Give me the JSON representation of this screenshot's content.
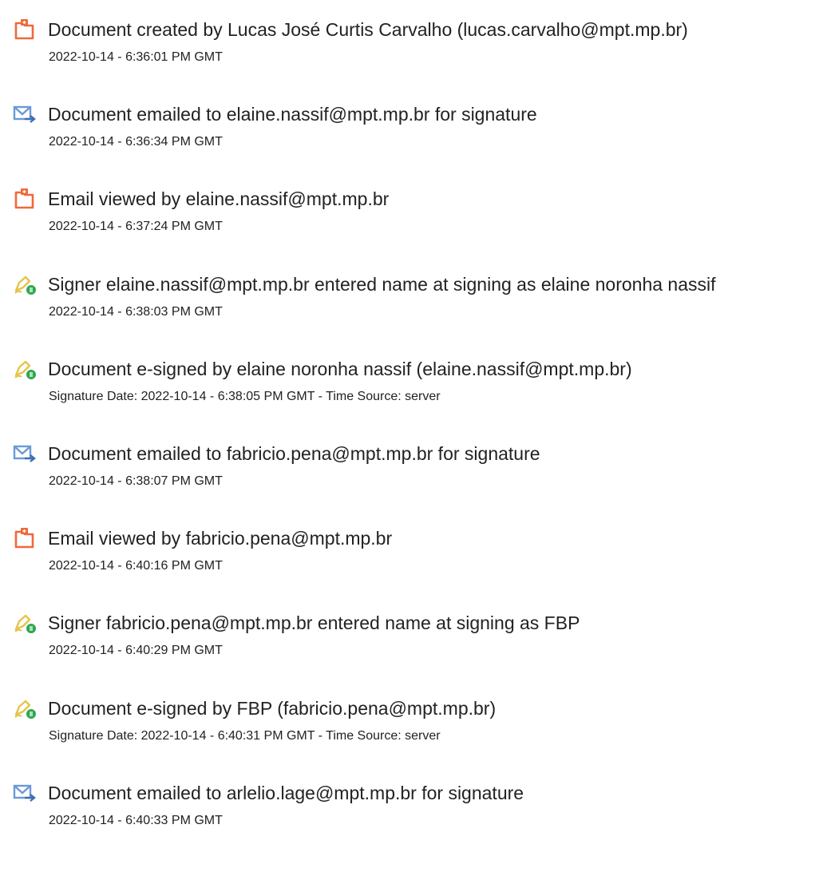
{
  "events": [
    {
      "icon": "document-created-icon",
      "title": "Document created by Lucas José Curtis Carvalho (lucas.carvalho@mpt.mp.br)",
      "detail": "2022-10-14 - 6:36:01 PM GMT"
    },
    {
      "icon": "email-sent-icon",
      "title": "Document emailed to elaine.nassif@mpt.mp.br for signature",
      "detail": "2022-10-14 - 6:36:34 PM GMT"
    },
    {
      "icon": "document-viewed-icon",
      "title": "Email viewed by elaine.nassif@mpt.mp.br",
      "detail": "2022-10-14 - 6:37:24 PM GMT"
    },
    {
      "icon": "pen-esign-icon",
      "title": "Signer elaine.nassif@mpt.mp.br entered name at signing as elaine noronha nassif",
      "detail": "2022-10-14 - 6:38:03 PM GMT"
    },
    {
      "icon": "pen-esign-icon",
      "title": "Document e-signed by elaine noronha nassif (elaine.nassif@mpt.mp.br)",
      "detail": "Signature Date: 2022-10-14 - 6:38:05 PM GMT - Time Source: server"
    },
    {
      "icon": "email-sent-icon",
      "title": "Document emailed to fabricio.pena@mpt.mp.br for signature",
      "detail": "2022-10-14 - 6:38:07 PM GMT"
    },
    {
      "icon": "document-viewed-icon",
      "title": "Email viewed by fabricio.pena@mpt.mp.br",
      "detail": "2022-10-14 - 6:40:16 PM GMT"
    },
    {
      "icon": "pen-esign-icon",
      "title": "Signer fabricio.pena@mpt.mp.br entered name at signing as FBP",
      "detail": "2022-10-14 - 6:40:29 PM GMT"
    },
    {
      "icon": "pen-esign-icon",
      "title": "Document e-signed by FBP (fabricio.pena@mpt.mp.br)",
      "detail": "Signature Date: 2022-10-14 - 6:40:31 PM GMT - Time Source: server"
    },
    {
      "icon": "email-sent-icon",
      "title": "Document emailed to arlelio.lage@mpt.mp.br for signature",
      "detail": "2022-10-14 - 6:40:33 PM GMT"
    }
  ],
  "colors": {
    "document_icon": "#f0683a",
    "email_icon": "#6a9ad6",
    "pen_icon": "#e7c34a",
    "esign_badge": "#2ea84f",
    "text": "#222222"
  }
}
